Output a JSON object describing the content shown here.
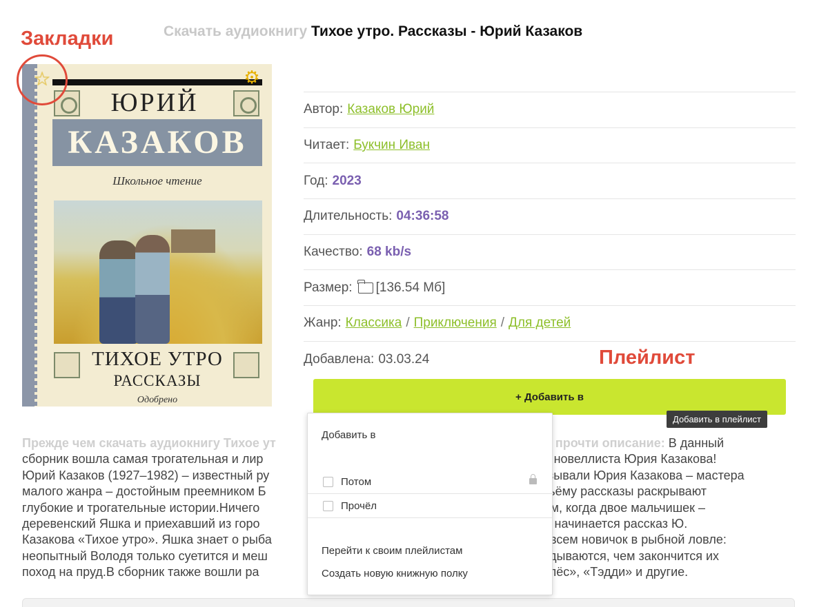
{
  "annotations": {
    "bookmarks": "Закладки",
    "playlist": "Плейлист"
  },
  "header": {
    "prefix": "Скачать аудиокнигу",
    "title": "Тихое утро. Рассказы - Юрий Казаков"
  },
  "cover": {
    "author_first": "ЮРИЙ",
    "author_last": "КАЗАКОВ",
    "series": "Школьное чтение",
    "title": "ТИХОЕ УТРО",
    "subtitle": "РАССКАЗЫ",
    "approved": "Одобрено"
  },
  "info": {
    "author_label": "Автор:",
    "author": "Казаков Юрий",
    "reader_label": "Читает:",
    "reader": "Букчин Иван",
    "year_label": "Год:",
    "year": "2023",
    "duration_label": "Длительность:",
    "duration": "04:36:58",
    "quality_label": "Качество:",
    "quality": "68 kb/s",
    "size_label": "Размер:",
    "size": "[136.54 Мб]",
    "genre_label": "Жанр:",
    "genres": [
      "Классика",
      "Приключения",
      "Для детей"
    ],
    "genre_sep": "/",
    "added_label": "Добавлена:",
    "added": "03.03.24"
  },
  "add_button": {
    "label": "+ Добавить в",
    "tooltip": "Добавить в плейлист"
  },
  "dropdown": {
    "header": "Добавить в",
    "options": [
      "Потом",
      "Прочёл"
    ],
    "link_playlists": "Перейти к своим плейлистам",
    "link_new_shelf": "Создать новую книжную полку"
  },
  "description": {
    "lead": "Прежде чем скачать аудиокнигу Тихое ут",
    "lead_tail": "mp3, прочти описание:",
    "lines": [
      "В данный",
      "сборник вошла самая трогательная и лир",
      "го новеллиста Юрия Казакова!",
      "Юрий Казаков (1927–1982) – известный ру",
      "называли Юрия Казакова – мастера",
      "малого жанра – достойным преемником Б",
      "объёму рассказы раскрывают",
      "глубокие и трогательные истории.Ничего",
      "утром, когда двое мальчишек –",
      "деревенский Яшка и приехавший из горо",
      ". Так начинается рассказ Ю.",
      "Казакова «Тихое утро». Яшка знает о рыба",
      "совсем новичок в рыбной ловле:",
      "неопытный Володя только суетится и меш",
      "гадываются, чем закончится их",
      "поход на пруд.В сборник также вошли ра",
      "ний пёс», «Тэдди» и другие."
    ]
  },
  "colors": {
    "annotation": "#e04a3a",
    "link": "#8dbf2a",
    "value": "#7a5fb0",
    "button": "#c9e62f"
  }
}
